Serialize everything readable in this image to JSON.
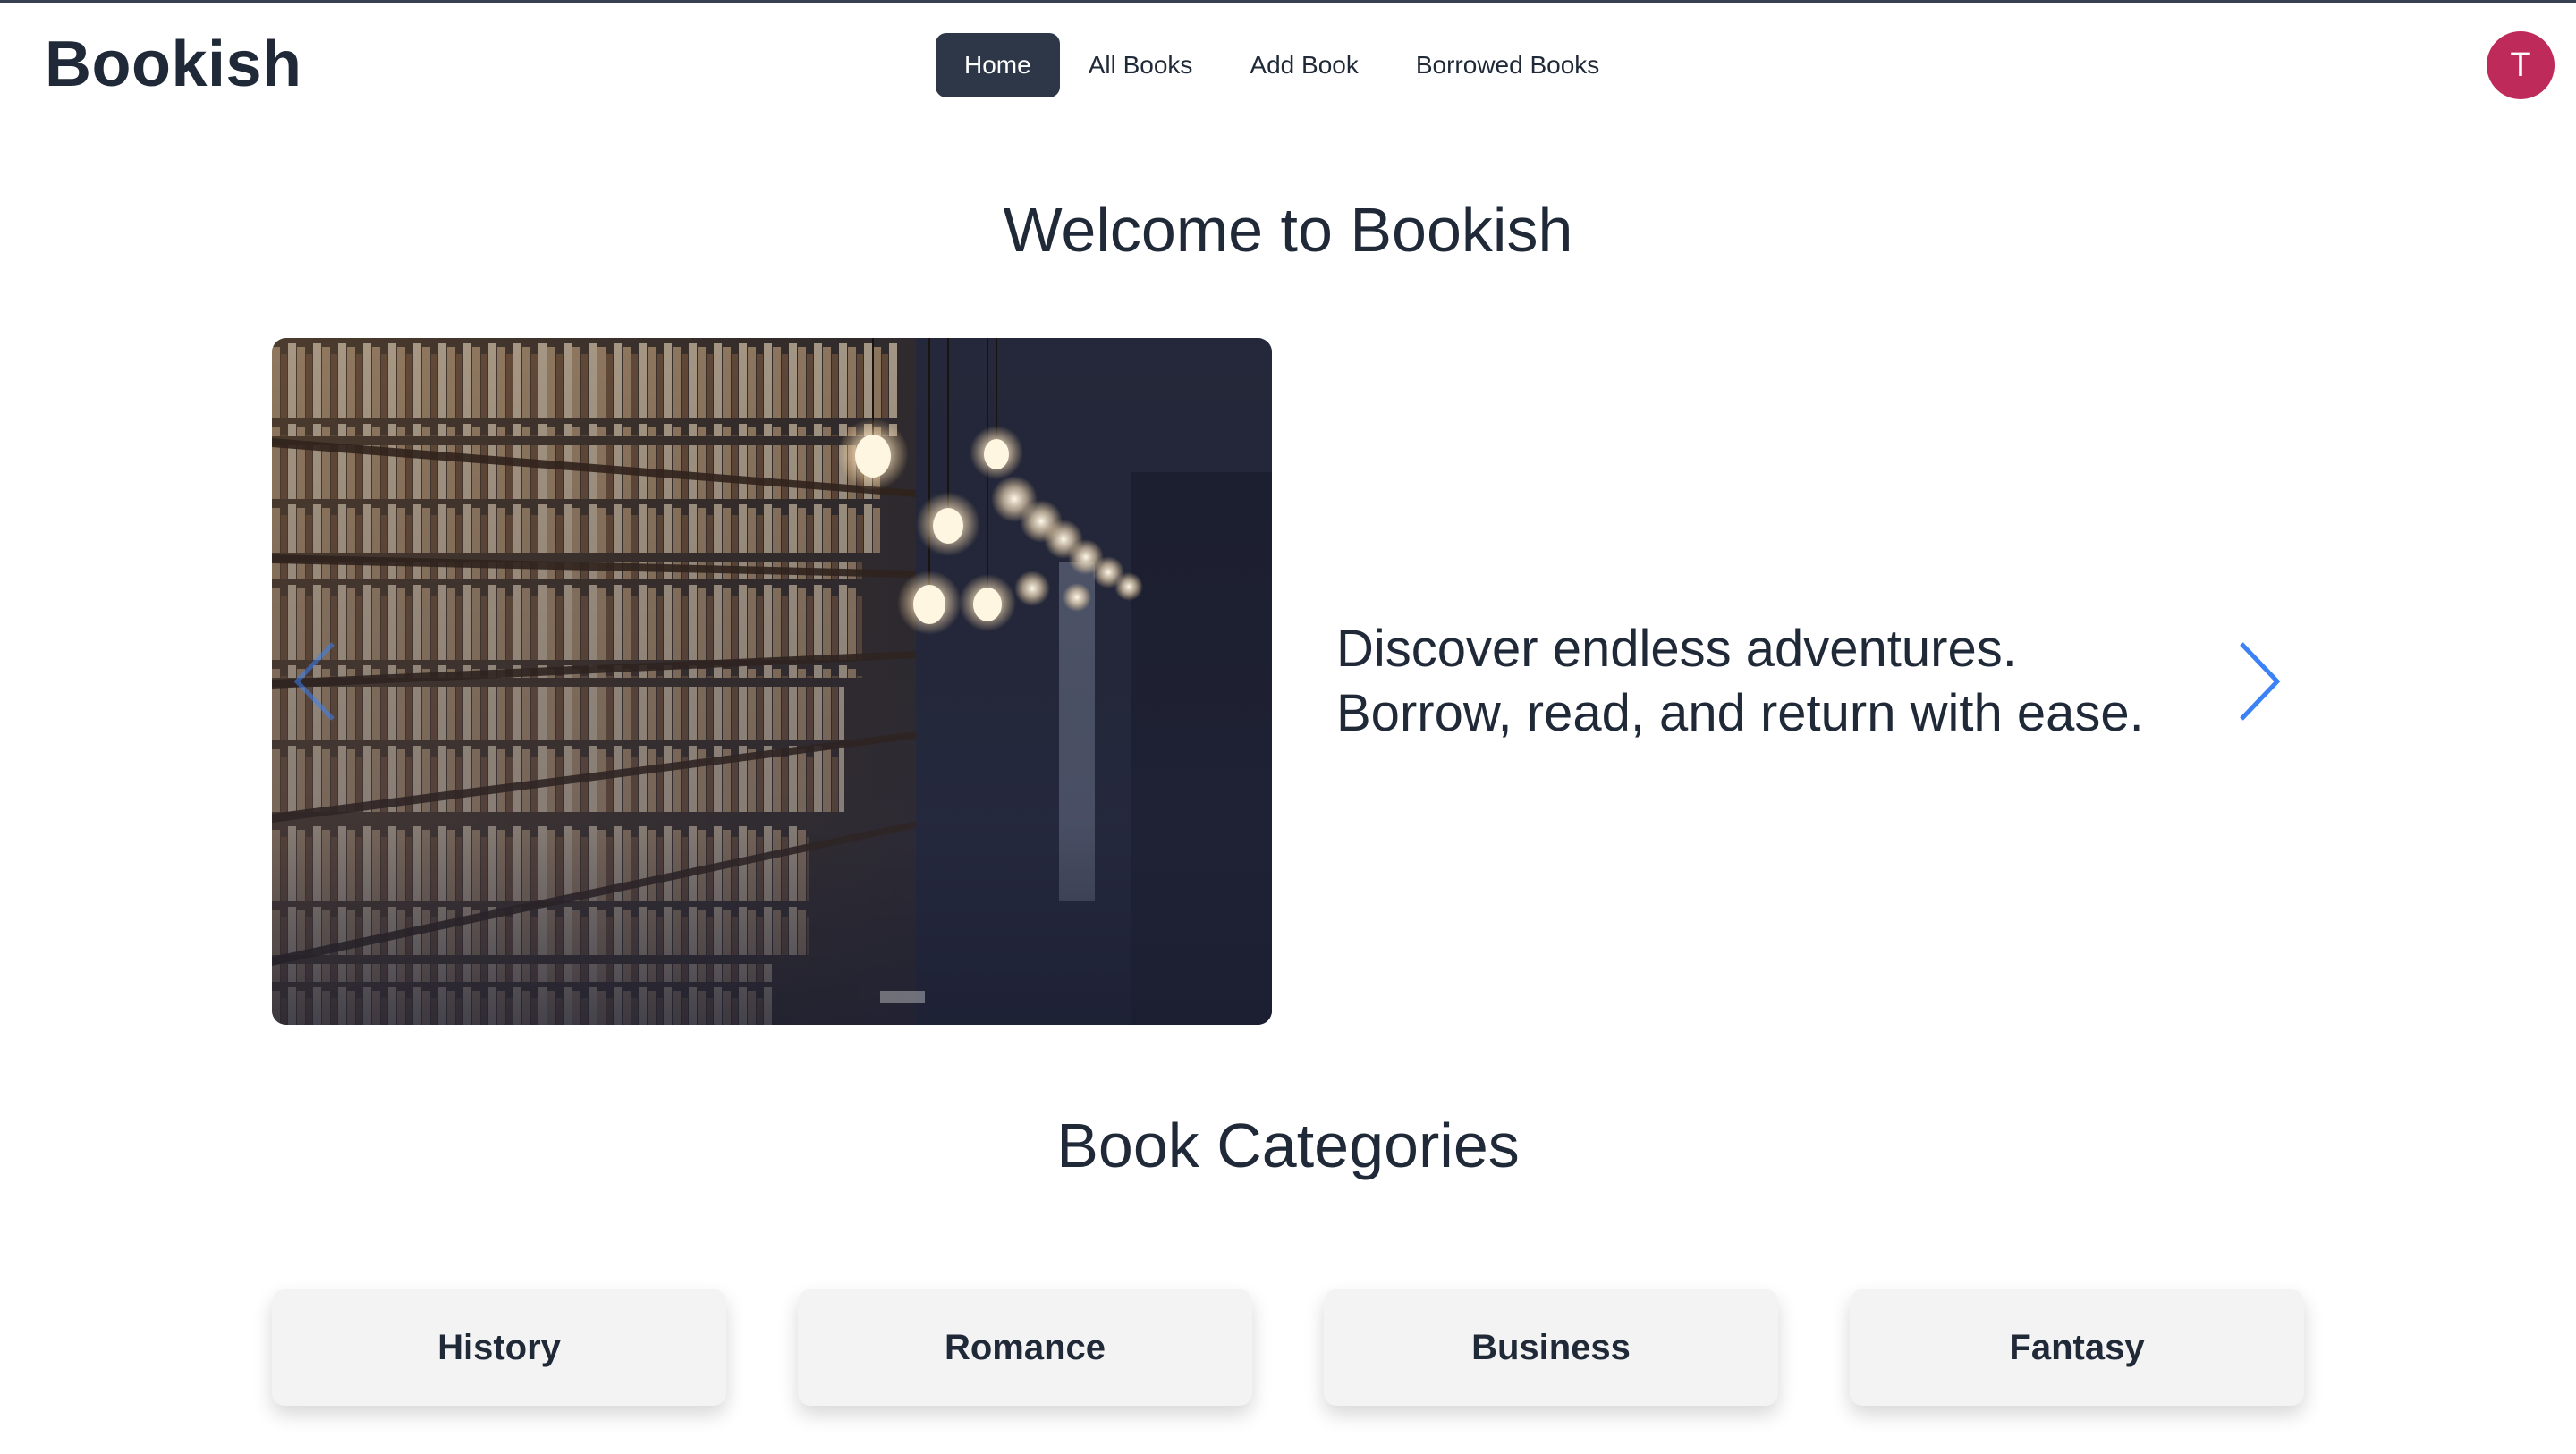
{
  "brand": "Bookish",
  "nav": {
    "items": [
      {
        "label": "Home",
        "active": true
      },
      {
        "label": "All Books",
        "active": false
      },
      {
        "label": "Add Book",
        "active": false
      },
      {
        "label": "Borrowed Books",
        "active": false
      }
    ]
  },
  "user": {
    "initial": "T",
    "avatar_color": "#be2a5a"
  },
  "hero": {
    "title": "Welcome to Bookish",
    "slide": {
      "line1": "Discover endless adventures.",
      "line2": "Borrow, read, and return with ease."
    },
    "prev_icon": "chevron-left-icon",
    "next_icon": "chevron-right-icon"
  },
  "categories": {
    "title": "Book Categories",
    "items": [
      {
        "label": "History"
      },
      {
        "label": "Romance"
      },
      {
        "label": "Business"
      },
      {
        "label": "Fantasy"
      }
    ]
  },
  "colors": {
    "accent": "#3b82f6",
    "nav_active_bg": "#2d3748",
    "text": "#1f2937",
    "card_bg": "#f3f3f3"
  }
}
